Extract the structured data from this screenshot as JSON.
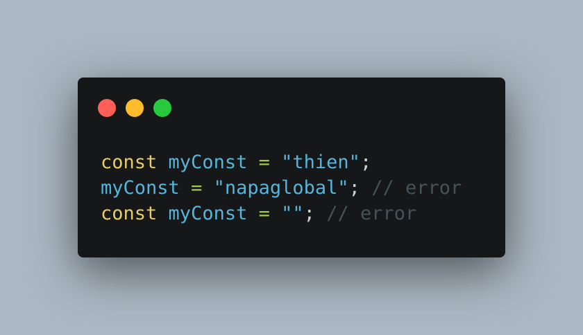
{
  "window_controls": {
    "close_color": "#ff5f56",
    "minimize_color": "#ffbd2e",
    "maximize_color": "#27c93f"
  },
  "colors": {
    "background": "#abb8c3",
    "window": "#151718",
    "keyword": "#e6cd69",
    "identifier": "#55b5db",
    "operator": "#9fca56",
    "string": "#55b5db",
    "punctuation": "#d0d2d4",
    "comment": "#41535b"
  },
  "code": {
    "lines": [
      {
        "keyword": "const",
        "identifier": "myConst",
        "operator": "=",
        "string": "\"thien\"",
        "terminator": ";"
      },
      {
        "identifier": "myConst",
        "operator": "=",
        "string": "\"napaglobal\"",
        "terminator": ";",
        "comment": "// error"
      },
      {
        "keyword": "const",
        "identifier": "myConst",
        "operator": "=",
        "string": "\"\"",
        "terminator": ";",
        "comment": "// error"
      }
    ]
  }
}
